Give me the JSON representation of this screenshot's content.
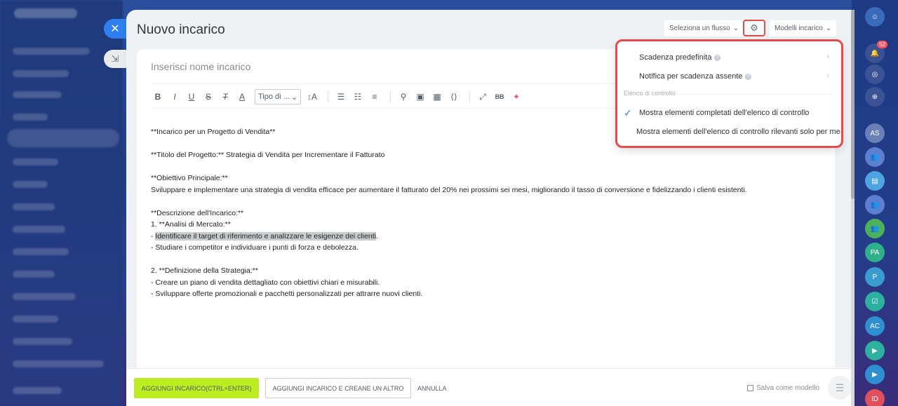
{
  "panel": {
    "title": "Nuovo incarico",
    "flow_select": "Seleziona un flusso",
    "templates_select": "Modelli incarico"
  },
  "editor": {
    "name_placeholder": "Inserisci nome incarico",
    "toolbar": {
      "bold": "B",
      "italic": "I",
      "underline": "U",
      "strike": "S",
      "clear_format": "T",
      "text_color": "A",
      "type_select": "Tipo di ...",
      "font_size": "↕A",
      "bb_code": "BB"
    },
    "body": [
      "**Incarico per un Progetto di Vendita**",
      "",
      "**Titolo del Progetto:** Strategia di Vendita per Incrementare il Fatturato",
      "",
      "**Obiettivo Principale:**",
      "Sviluppare e implementare una strategia di vendita efficace per aumentare il fatturato del 20% nei prossimi sei mesi, migliorando il tasso di conversione e fidelizzando i clienti esistenti.",
      "",
      "**Descrizione dell'Incarico:**",
      "1. **Analisi di Mercato:**",
      "HIGHLIGHT",
      "- Studiare i competitor e individuare i punti di forza e debolezza.",
      "",
      "2. **Definizione della Strategia:**",
      "- Creare un piano di vendita dettagliato con obiettivi chiari e misurabili.",
      "- Sviluppare offerte promozionali e pacchetti personalizzati per attrarre nuovi clienti."
    ],
    "highlight_line": {
      "prefix": "- ",
      "highlighted": "Identificare il target di riferimento e analizzare le esigenze dei clienti",
      "suffix": "."
    }
  },
  "settings_menu": {
    "default_deadline": "Scadenza predefinita",
    "missing_deadline": "Notifica per scadenza assente",
    "checklist_section": "Elenco di controllo",
    "show_completed": "Mostra elementi completati dell'elenco di controllo",
    "show_relevant": "Mostra elementi dell'elenco di controllo rilevanti solo per me"
  },
  "footer": {
    "add_button": "AGGIUNGI INCARICO(CTRL+ENTER)",
    "add_another_button": "AGGIUNGI INCARICO E CREANE UN ALTRO",
    "cancel": "ANNULLA",
    "save_template": "Salva come modello"
  },
  "right_sidebar": {
    "notification_count": "52",
    "avatars": [
      "AS",
      "PA",
      "P",
      "AC",
      "ID"
    ]
  },
  "colors": {
    "primary_button": "#bbed21",
    "accent_red": "#e54b4b",
    "accent_blue": "#2f7ef0"
  }
}
